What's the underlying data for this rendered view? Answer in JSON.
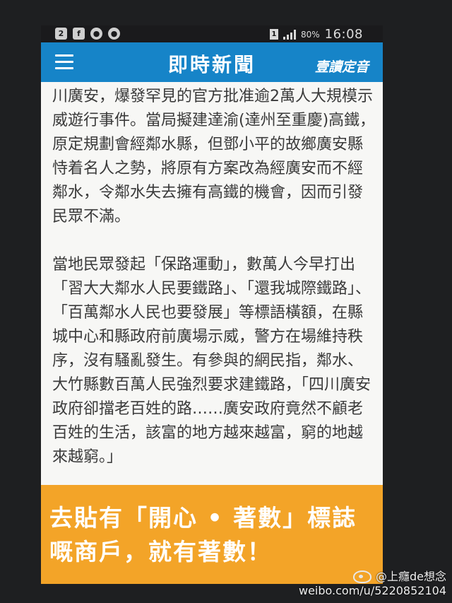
{
  "status_bar": {
    "time": "16:08",
    "battery": "80%",
    "sim": "1",
    "left_icons": [
      "badge-2-icon",
      "facebook-icon",
      "apple-icon",
      "apple-icon"
    ]
  },
  "app_bar": {
    "title": "即時新聞",
    "brand": "壹讀定音"
  },
  "article": {
    "paragraphs": [
      "川廣安，爆發罕見的官方批准逾2萬人大規模示威遊行事件。當局擬建達渝(達州至重慶)高鐵，原定規劃會經鄰水縣，但鄧小平的故鄉廣安縣恃着名人之勢，將原有方案改為經廣安而不經鄰水，令鄰水失去擁有高鐵的機會，因而引發民眾不滿。",
      "當地民眾發起「保路運動」，數萬人今早打出「習大大鄰水人民要鐵路」、「還我城際鐵路」、「百萬鄰水人民也要發展」等標語橫額，在縣城中心和縣政府前廣場示威，警方在場維持秩序，沒有騷亂發生。有參與的網民指，鄰水、大竹縣數百萬人民強烈要求建鐵路，「四川廣安政府卻擋老百姓的路……廣安政府竟然不顧老百姓的生活，該富的地方越來越富，窮的地越來越窮。」"
    ]
  },
  "ad_banner": {
    "line1": "去貼有「開心 • 著數」標誌",
    "line2": "嘅商戶，就有著數！"
  },
  "watermark": {
    "handle": "@上癮de想念",
    "url": "weibo.com/u/5220852104"
  },
  "colors": {
    "app_bar": "#1684c8",
    "ad_banner": "#f3a428",
    "article_bg": "#f7f7f5",
    "article_text": "#3a3a3a"
  }
}
